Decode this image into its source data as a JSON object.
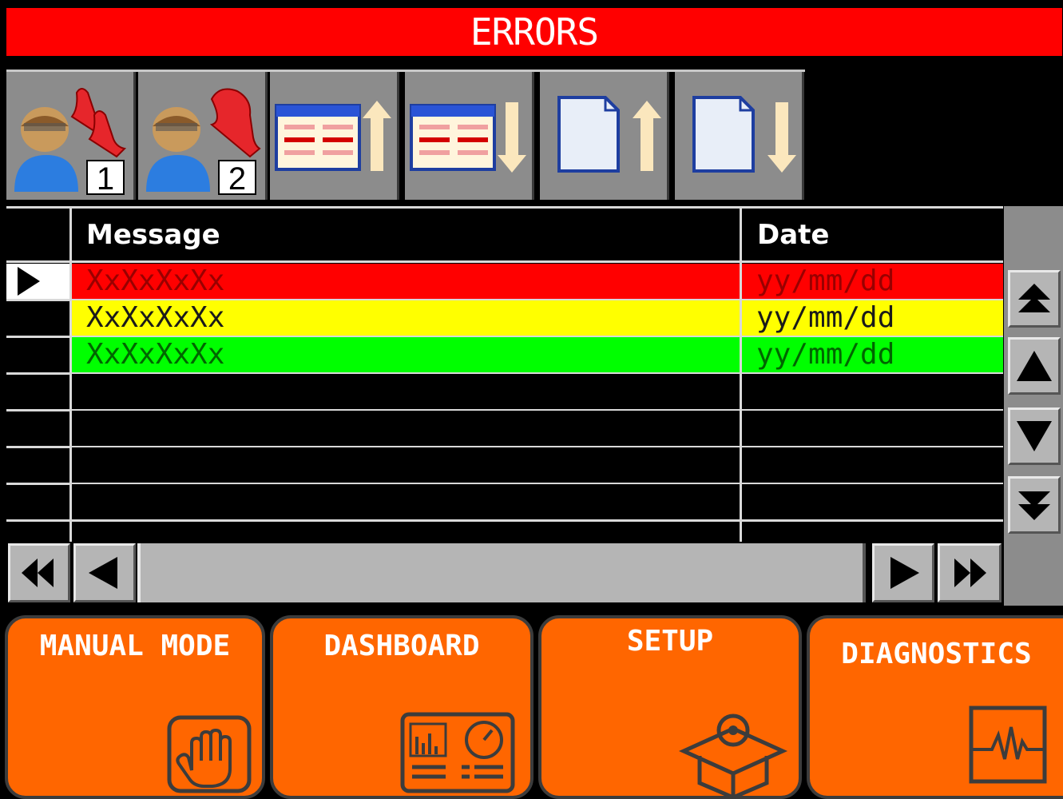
{
  "title": "ERRORS",
  "toolbar": {
    "buttons": [
      {
        "icon": "user-alarm-icon",
        "badge": "1"
      },
      {
        "icon": "user-alarm-icon",
        "badge": "2"
      },
      {
        "icon": "table-sort-up-icon"
      },
      {
        "icon": "table-sort-down-icon"
      },
      {
        "icon": "page-up-icon"
      },
      {
        "icon": "page-down-icon"
      }
    ]
  },
  "table": {
    "columns": [
      "Message",
      "Date"
    ],
    "rows": [
      {
        "message": "XxXxXxXx",
        "date": "yy/mm/dd",
        "bg": "#ff0000",
        "fg": "#990000",
        "selected": true
      },
      {
        "message": "XxXxXxXx",
        "date": "yy/mm/dd",
        "bg": "#ffff00",
        "fg": "#1a1a1a",
        "selected": false
      },
      {
        "message": "XxXxXxXx",
        "date": "yy/mm/dd",
        "bg": "#00ff00",
        "fg": "#006600",
        "selected": false
      },
      {
        "message": "",
        "date": "",
        "bg": "#000000",
        "fg": "#000000",
        "selected": false
      },
      {
        "message": "",
        "date": "",
        "bg": "#000000",
        "fg": "#000000",
        "selected": false
      },
      {
        "message": "",
        "date": "",
        "bg": "#000000",
        "fg": "#000000",
        "selected": false
      },
      {
        "message": "",
        "date": "",
        "bg": "#000000",
        "fg": "#000000",
        "selected": false
      }
    ]
  },
  "scroll": {
    "vertical": [
      "first-page-icon",
      "prev-row-icon",
      "next-row-icon",
      "last-page-icon"
    ],
    "horizontal": [
      "scroll-left-end-icon",
      "scroll-left-icon",
      "scroll-right-icon",
      "scroll-right-end-icon"
    ]
  },
  "nav": {
    "manual_mode": "MANUAL MODE",
    "dashboard": "DASHBOARD",
    "setup": "SETUP",
    "diagnostics": "DIAGNOSTICS"
  },
  "colors": {
    "title_bg": "#ff0000",
    "nav_bg": "#ff6600",
    "toolbar_bg": "#8c8c8c"
  }
}
